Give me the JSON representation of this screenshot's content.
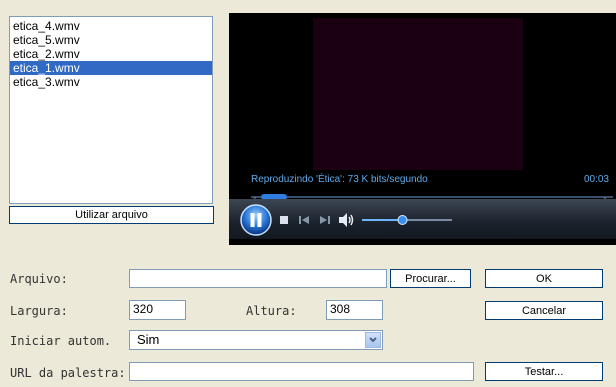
{
  "files": [
    "etica_4.wmv",
    "etica_5.wmv",
    "etica_2.wmv",
    "etica_1.wmv",
    "etica_3.wmv"
  ],
  "selected_file_index": 3,
  "use_file_button": "Utilizar arquivo",
  "player": {
    "status_text": "Reproduzindo 'Ética': 73 K bits/segundo",
    "time": "00:03",
    "volume_level": 0.45
  },
  "form": {
    "arquivo_label": "Arquivo:",
    "arquivo_value": "",
    "browse_button": "Procurar...",
    "ok_button": "OK",
    "largura_label": "Largura:",
    "largura_value": "320",
    "altura_label": "Altura:",
    "altura_value": "308",
    "cancel_button": "Cancelar",
    "autostart_label": "Iniciar autom.",
    "autostart_value": "Sim",
    "url_label": "URL da palestra:",
    "url_value": "",
    "test_button": "Testar..."
  },
  "colors": {
    "selection": "#316ac5",
    "accent_blue": "#2f7de0",
    "status_text": "#5fa9e8"
  },
  "icons": [
    "play-pause-icon",
    "stop-icon",
    "previous-icon",
    "next-icon",
    "volume-icon"
  ]
}
